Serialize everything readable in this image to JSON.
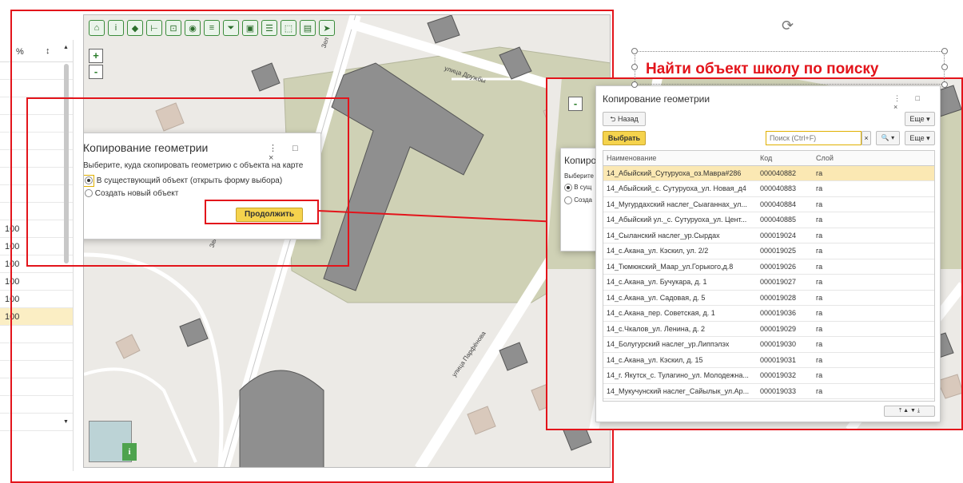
{
  "annotation": {
    "text": "Найти объект  школу по поиску"
  },
  "left_list": {
    "col_percent": "%",
    "col_sort": "↕",
    "rows": [
      "",
      "",
      "",
      "",
      "",
      "",
      "",
      "",
      "",
      "100",
      "100",
      "100",
      "100",
      "100",
      "100",
      "",
      "",
      "",
      "",
      "",
      ""
    ],
    "selected_row": 14
  },
  "map": {
    "zoom_in": "+",
    "zoom_out": "-",
    "info": "i",
    "streets": {
      "druzhby": "улица Дружбы",
      "parfenova": "улица Парфёнова",
      "zel": "Зел"
    }
  },
  "toolbar_icons": [
    "home-icon",
    "info-icon",
    "pan-icon",
    "measure-icon",
    "measure-area-icon",
    "marker-icon",
    "filter-icon",
    "funnel-icon",
    "layers-icon",
    "identify-icon",
    "select-icon",
    "print-icon",
    "route-icon"
  ],
  "dialog_small": {
    "title": "Копирование геометрии",
    "controls": "⋮ □ ×",
    "prompt": "Выберите, куда скопировать геометрию с объекта на карте",
    "option1": "В существующий объект (открыть форму выбора)",
    "option2": "Создать новый объект",
    "continue": "Продолжить"
  },
  "dialog_behind": {
    "title": "Копиро",
    "prompt": "Выберите",
    "option1": "В сущ",
    "option2": "Созда"
  },
  "dialog_big": {
    "title": "Копирование геометрии",
    "controls": "⋮ □ ×",
    "back": "Назад",
    "more": "Еще ▾",
    "select": "Выбрать",
    "search_placeholder": "Поиск (Ctrl+F)",
    "search_clear": "×",
    "search_btn": "🔍 ▾",
    "columns": [
      "Наименование",
      "Код",
      "Слой"
    ],
    "rows": [
      [
        "14_Абыйский_Сутуруоха_оз.Мавра#286",
        "000040882",
        "га"
      ],
      [
        "14_Абыйский_с. Сутуруоха_ул. Новая_д4",
        "000040883",
        "га"
      ],
      [
        "14_Мугурдахский наслег_Сыаганнах_ул...",
        "000040884",
        "га"
      ],
      [
        "14_Абыйский ул._с. Сутуруоха_ул. Цент...",
        "000040885",
        "га"
      ],
      [
        "14_Сыланский наслег_ур.Сырдах",
        "000019024",
        "га"
      ],
      [
        "14_с.Акана_ул. Кэскил, ул. 2/2",
        "000019025",
        "га"
      ],
      [
        "14_Тюмюкский_Маар_ул.Горького,д.8",
        "000019026",
        "га"
      ],
      [
        "14_с.Акана_ул. Бучукара, д. 1",
        "000019027",
        "га"
      ],
      [
        "14_с.Акана_ул. Садовая, д. 5",
        "000019028",
        "га"
      ],
      [
        "14_с.Акана_пер. Советская, д. 1",
        "000019036",
        "га"
      ],
      [
        "14_с.Чкалов_ул. Ленина, д. 2",
        "000019029",
        "га"
      ],
      [
        "14_Болугурский наслег_ур.Липпэлэх",
        "000019030",
        "га"
      ],
      [
        "14_с.Акана_ул. Кэскил, д. 15",
        "000019031",
        "га"
      ],
      [
        "14_г. Якутск_с. Тулагино_ул. Молодежна...",
        "000019032",
        "га"
      ],
      [
        "14_Мукучунский наслег_Сайылык_ул.Ар...",
        "000019033",
        "га"
      ]
    ],
    "nav": "⤒ ▲ ▼ ⤓"
  },
  "colors": {
    "highlight": "#e3141b",
    "accent": "#f5d34d",
    "building": "#8f8f8f",
    "park": "#cfd1b5"
  }
}
